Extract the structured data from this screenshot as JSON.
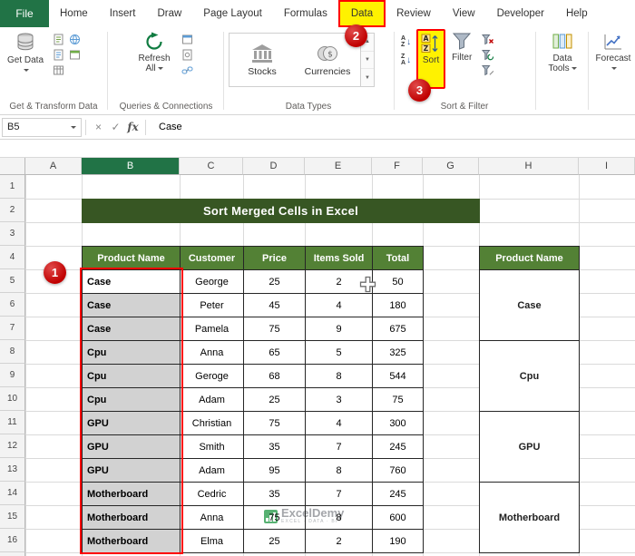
{
  "colors": {
    "excel_green": "#217346",
    "banner_green": "#375623",
    "header_green": "#538135",
    "annotation_red": "#C00000",
    "highlight_red": "#FF0000",
    "highlight_yellow": "#FFF200",
    "selection_gray": "#D2D2D2"
  },
  "ribbon": {
    "file_tab": "File",
    "tabs": [
      "Home",
      "Insert",
      "Draw",
      "Page Layout",
      "Formulas",
      "Data",
      "Review",
      "View",
      "Developer",
      "Help"
    ],
    "active_tab": "Data",
    "get_transform": {
      "get_data": "Get Data",
      "label": "Get & Transform Data"
    },
    "queries": {
      "refresh_all": "Refresh All",
      "label": "Queries & Connections"
    },
    "data_types": {
      "stocks": "Stocks",
      "currencies": "Currencies",
      "label": "Data Types"
    },
    "sort_filter": {
      "sort": "Sort",
      "filter": "Filter",
      "label": "Sort & Filter"
    },
    "data_tools": "Data Tools",
    "forecast": "Forecast"
  },
  "formula_bar": {
    "name_box": "B5",
    "fx": "fx",
    "value": "Case"
  },
  "annotations": {
    "step1": "1",
    "step2": "2",
    "step3": "3"
  },
  "grid": {
    "columns": [
      "A",
      "B",
      "C",
      "D",
      "E",
      "F",
      "G",
      "H",
      "I"
    ],
    "rows": [
      "1",
      "2",
      "3",
      "4",
      "5",
      "6",
      "7",
      "8",
      "9",
      "10",
      "11",
      "12",
      "13",
      "14",
      "15",
      "16"
    ],
    "selected_column": "B"
  },
  "sheet": {
    "banner": "Sort Merged Cells in Excel",
    "table": {
      "headers": [
        "Product Name",
        "Customer",
        "Price",
        "Items Sold",
        "Total"
      ],
      "rows": [
        [
          "Case",
          "George",
          "25",
          "2",
          "50"
        ],
        [
          "Case",
          "Peter",
          "45",
          "4",
          "180"
        ],
        [
          "Case",
          "Pamela",
          "75",
          "9",
          "675"
        ],
        [
          "Cpu",
          "Anna",
          "65",
          "5",
          "325"
        ],
        [
          "Cpu",
          "Geroge",
          "68",
          "8",
          "544"
        ],
        [
          "Cpu",
          "Adam",
          "25",
          "3",
          "75"
        ],
        [
          "GPU",
          "Christian",
          "75",
          "4",
          "300"
        ],
        [
          "GPU",
          "Smith",
          "35",
          "7",
          "245"
        ],
        [
          "GPU",
          "Adam",
          "95",
          "8",
          "760"
        ],
        [
          "Motherboard",
          "Cedric",
          "35",
          "7",
          "245"
        ],
        [
          "Motherboard",
          "Anna",
          "75",
          "8",
          "600"
        ],
        [
          "Motherboard",
          "Elma",
          "25",
          "2",
          "190"
        ]
      ]
    },
    "merged_table": {
      "header": "Product Name",
      "groups": [
        {
          "label": "Case",
          "rows": 3
        },
        {
          "label": "Cpu",
          "rows": 3
        },
        {
          "label": "GPU",
          "rows": 3
        },
        {
          "label": "Motherboard",
          "rows": 3
        }
      ]
    },
    "watermark": {
      "name": "ExcelDemy",
      "tagline": "EXCEL · DATA · BI"
    }
  }
}
